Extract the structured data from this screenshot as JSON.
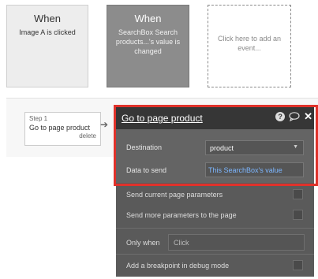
{
  "events": [
    {
      "title": "When",
      "subtitle": "Image A is clicked"
    },
    {
      "title": "When",
      "subtitle": "SearchBox Search products...'s value is changed"
    },
    {
      "title": "",
      "subtitle": "Click here to add an event..."
    }
  ],
  "step": {
    "label": "Step 1",
    "name": "Go to page product",
    "delete_label": "delete"
  },
  "panel": {
    "title": "Go to page product",
    "destination_label": "Destination",
    "destination_value": "product",
    "data_label": "Data to send",
    "data_value": "This SearchBox's value",
    "send_current_label": "Send current page parameters",
    "send_more_label": "Send more parameters to the page",
    "only_when_label": "Only when",
    "only_when_placeholder": "Click",
    "breakpoint_label": "Add a breakpoint in debug mode"
  },
  "colors": {
    "highlight": "#e0322b",
    "link": "#7cb6ff"
  }
}
